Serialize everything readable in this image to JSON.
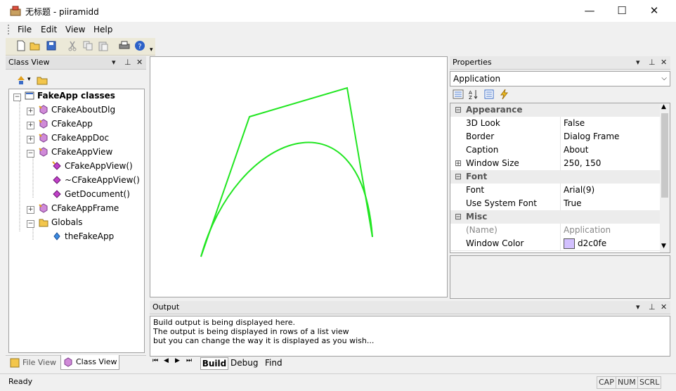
{
  "window": {
    "title": "无标题 - piiramidd",
    "minimize": "—",
    "maximize": "☐",
    "close": "✕"
  },
  "menu": [
    "File",
    "Edit",
    "View",
    "Help"
  ],
  "class_view": {
    "title": "Class View",
    "tree": [
      {
        "label": "FakeApp classes",
        "bold": true
      },
      {
        "label": "CFakeAboutDlg"
      },
      {
        "label": "CFakeApp"
      },
      {
        "label": "CFakeAppDoc"
      },
      {
        "label": "CFakeAppView"
      },
      {
        "label": "CFakeAppView()"
      },
      {
        "label": "~CFakeAppView()"
      },
      {
        "label": "GetDocument()"
      },
      {
        "label": "CFakeAppFrame"
      },
      {
        "label": "Globals"
      },
      {
        "label": "theFakeApp"
      }
    ],
    "tabs": [
      "File View",
      "Class View"
    ]
  },
  "properties": {
    "title": "Properties",
    "object": "Application",
    "categories": {
      "appearance": "Appearance",
      "font": "Font",
      "misc": "Misc"
    },
    "rows": {
      "look3d": {
        "name": "3D Look",
        "value": "False"
      },
      "border": {
        "name": "Border",
        "value": "Dialog Frame"
      },
      "caption": {
        "name": "Caption",
        "value": "About"
      },
      "window_size": {
        "name": "Window Size",
        "value": "250, 150"
      },
      "font": {
        "name": "Font",
        "value": "Arial(9)"
      },
      "use_system_font": {
        "name": "Use System Font",
        "value": "True"
      },
      "name": {
        "name": "(Name)",
        "value": "Application"
      },
      "window_color": {
        "name": "Window Color",
        "value": "d2c0fe"
      }
    },
    "window_color_swatch": "#d2c0fe"
  },
  "output": {
    "title": "Output",
    "lines": [
      "Build output is being displayed here.",
      "The output is being displayed in rows of a list view",
      "but you can change the way it is displayed as you wish..."
    ],
    "tabs": [
      "Build",
      "Debug",
      "Find"
    ]
  },
  "status": {
    "text": "Ready",
    "indicators": [
      "CAP",
      "NUM",
      "SCRL"
    ]
  },
  "colors": {
    "curve": "#22e622"
  },
  "icons": [
    "app-icon",
    "new-icon",
    "open-icon",
    "save-icon",
    "cut-icon",
    "copy-icon",
    "paste-icon",
    "print-icon",
    "help-icon",
    "pin-icon",
    "close-icon",
    "dropdown-icon",
    "class-icon",
    "folder-icon",
    "method-icon",
    "variable-icon"
  ]
}
